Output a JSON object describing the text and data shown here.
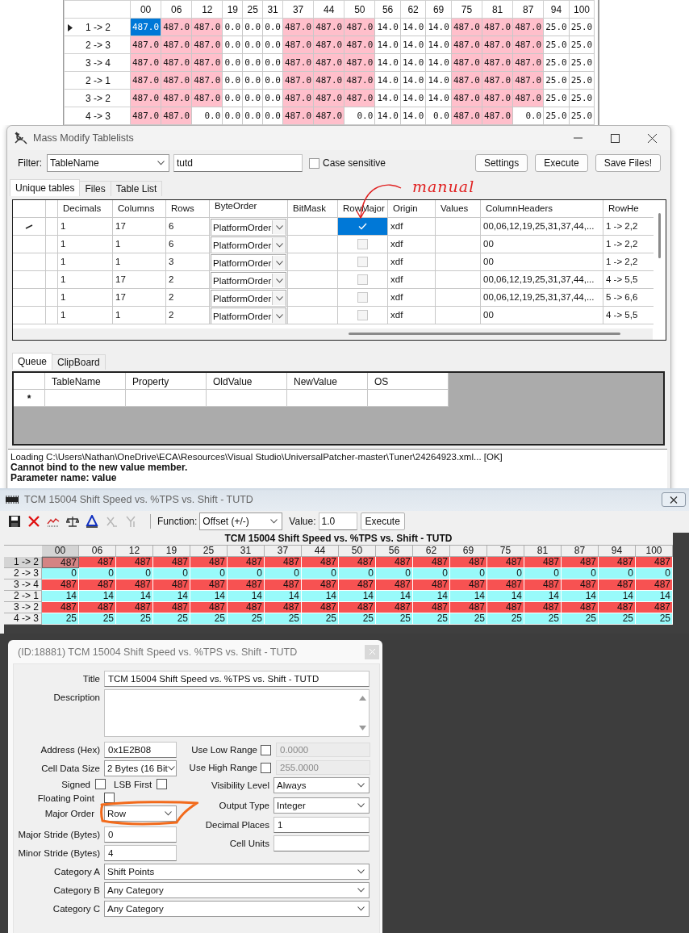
{
  "value_grid": {
    "columns": [
      "00",
      "06",
      "12",
      "19",
      "25",
      "31",
      "37",
      "44",
      "50",
      "56",
      "62",
      "69",
      "75",
      "81",
      "87",
      "94",
      "100"
    ],
    "rows": [
      {
        "label": "1 -> 2",
        "current": true,
        "cells": [
          {
            "value": "487.0",
            "highlighted": true,
            "selected": true
          },
          {
            "value": "487.0",
            "highlighted": true,
            "selected": false
          },
          {
            "value": "487.0",
            "highlighted": true,
            "selected": false
          },
          {
            "value": "0.0",
            "highlighted": false,
            "selected": false
          },
          {
            "value": "0.0",
            "highlighted": false,
            "selected": false
          },
          {
            "value": "0.0",
            "highlighted": false,
            "selected": false
          },
          {
            "value": "487.0",
            "highlighted": true,
            "selected": false
          },
          {
            "value": "487.0",
            "highlighted": true,
            "selected": false
          },
          {
            "value": "487.0",
            "highlighted": true,
            "selected": false
          },
          {
            "value": "14.0",
            "highlighted": false,
            "selected": false
          },
          {
            "value": "14.0",
            "highlighted": false,
            "selected": false
          },
          {
            "value": "14.0",
            "highlighted": false,
            "selected": false
          },
          {
            "value": "487.0",
            "highlighted": true,
            "selected": false
          },
          {
            "value": "487.0",
            "highlighted": true,
            "selected": false
          },
          {
            "value": "487.0",
            "highlighted": true,
            "selected": false
          },
          {
            "value": "25.0",
            "highlighted": false,
            "selected": false
          },
          {
            "value": "25.0",
            "highlighted": false,
            "selected": false
          }
        ]
      },
      {
        "label": "2 -> 3",
        "current": false,
        "cells": [
          {
            "value": "487.0",
            "highlighted": true,
            "selected": false
          },
          {
            "value": "487.0",
            "highlighted": true,
            "selected": false
          },
          {
            "value": "487.0",
            "highlighted": true,
            "selected": false
          },
          {
            "value": "0.0",
            "highlighted": false,
            "selected": false
          },
          {
            "value": "0.0",
            "highlighted": false,
            "selected": false
          },
          {
            "value": "0.0",
            "highlighted": false,
            "selected": false
          },
          {
            "value": "487.0",
            "highlighted": true,
            "selected": false
          },
          {
            "value": "487.0",
            "highlighted": true,
            "selected": false
          },
          {
            "value": "487.0",
            "highlighted": true,
            "selected": false
          },
          {
            "value": "14.0",
            "highlighted": false,
            "selected": false
          },
          {
            "value": "14.0",
            "highlighted": false,
            "selected": false
          },
          {
            "value": "14.0",
            "highlighted": false,
            "selected": false
          },
          {
            "value": "487.0",
            "highlighted": true,
            "selected": false
          },
          {
            "value": "487.0",
            "highlighted": true,
            "selected": false
          },
          {
            "value": "487.0",
            "highlighted": true,
            "selected": false
          },
          {
            "value": "25.0",
            "highlighted": false,
            "selected": false
          },
          {
            "value": "25.0",
            "highlighted": false,
            "selected": false
          }
        ]
      },
      {
        "label": "3 -> 4",
        "current": false,
        "cells": [
          {
            "value": "487.0",
            "highlighted": true,
            "selected": false
          },
          {
            "value": "487.0",
            "highlighted": true,
            "selected": false
          },
          {
            "value": "487.0",
            "highlighted": true,
            "selected": false
          },
          {
            "value": "0.0",
            "highlighted": false,
            "selected": false
          },
          {
            "value": "0.0",
            "highlighted": false,
            "selected": false
          },
          {
            "value": "0.0",
            "highlighted": false,
            "selected": false
          },
          {
            "value": "487.0",
            "highlighted": true,
            "selected": false
          },
          {
            "value": "487.0",
            "highlighted": true,
            "selected": false
          },
          {
            "value": "487.0",
            "highlighted": true,
            "selected": false
          },
          {
            "value": "14.0",
            "highlighted": false,
            "selected": false
          },
          {
            "value": "14.0",
            "highlighted": false,
            "selected": false
          },
          {
            "value": "14.0",
            "highlighted": false,
            "selected": false
          },
          {
            "value": "487.0",
            "highlighted": true,
            "selected": false
          },
          {
            "value": "487.0",
            "highlighted": true,
            "selected": false
          },
          {
            "value": "487.0",
            "highlighted": true,
            "selected": false
          },
          {
            "value": "25.0",
            "highlighted": false,
            "selected": false
          },
          {
            "value": "25.0",
            "highlighted": false,
            "selected": false
          }
        ]
      },
      {
        "label": "2 -> 1",
        "current": false,
        "cells": [
          {
            "value": "487.0",
            "highlighted": true,
            "selected": false
          },
          {
            "value": "487.0",
            "highlighted": true,
            "selected": false
          },
          {
            "value": "487.0",
            "highlighted": true,
            "selected": false
          },
          {
            "value": "0.0",
            "highlighted": false,
            "selected": false
          },
          {
            "value": "0.0",
            "highlighted": false,
            "selected": false
          },
          {
            "value": "0.0",
            "highlighted": false,
            "selected": false
          },
          {
            "value": "487.0",
            "highlighted": true,
            "selected": false
          },
          {
            "value": "487.0",
            "highlighted": true,
            "selected": false
          },
          {
            "value": "487.0",
            "highlighted": true,
            "selected": false
          },
          {
            "value": "14.0",
            "highlighted": false,
            "selected": false
          },
          {
            "value": "14.0",
            "highlighted": false,
            "selected": false
          },
          {
            "value": "14.0",
            "highlighted": false,
            "selected": false
          },
          {
            "value": "487.0",
            "highlighted": true,
            "selected": false
          },
          {
            "value": "487.0",
            "highlighted": true,
            "selected": false
          },
          {
            "value": "487.0",
            "highlighted": true,
            "selected": false
          },
          {
            "value": "25.0",
            "highlighted": false,
            "selected": false
          },
          {
            "value": "25.0",
            "highlighted": false,
            "selected": false
          }
        ]
      },
      {
        "label": "3 -> 2",
        "current": false,
        "cells": [
          {
            "value": "487.0",
            "highlighted": true,
            "selected": false
          },
          {
            "value": "487.0",
            "highlighted": true,
            "selected": false
          },
          {
            "value": "487.0",
            "highlighted": true,
            "selected": false
          },
          {
            "value": "0.0",
            "highlighted": false,
            "selected": false
          },
          {
            "value": "0.0",
            "highlighted": false,
            "selected": false
          },
          {
            "value": "0.0",
            "highlighted": false,
            "selected": false
          },
          {
            "value": "487.0",
            "highlighted": true,
            "selected": false
          },
          {
            "value": "487.0",
            "highlighted": true,
            "selected": false
          },
          {
            "value": "487.0",
            "highlighted": true,
            "selected": false
          },
          {
            "value": "14.0",
            "highlighted": false,
            "selected": false
          },
          {
            "value": "14.0",
            "highlighted": false,
            "selected": false
          },
          {
            "value": "14.0",
            "highlighted": false,
            "selected": false
          },
          {
            "value": "487.0",
            "highlighted": true,
            "selected": false
          },
          {
            "value": "487.0",
            "highlighted": true,
            "selected": false
          },
          {
            "value": "487.0",
            "highlighted": true,
            "selected": false
          },
          {
            "value": "25.0",
            "highlighted": false,
            "selected": false
          },
          {
            "value": "25.0",
            "highlighted": false,
            "selected": false
          }
        ]
      },
      {
        "label": "4 -> 3",
        "current": false,
        "cells": [
          {
            "value": "487.0",
            "highlighted": true,
            "selected": false
          },
          {
            "value": "487.0",
            "highlighted": true,
            "selected": false
          },
          {
            "value": "0.0",
            "highlighted": false,
            "selected": false
          },
          {
            "value": "0.0",
            "highlighted": false,
            "selected": false
          },
          {
            "value": "0.0",
            "highlighted": false,
            "selected": false
          },
          {
            "value": "0.0",
            "highlighted": false,
            "selected": false
          },
          {
            "value": "487.0",
            "highlighted": true,
            "selected": false
          },
          {
            "value": "487.0",
            "highlighted": true,
            "selected": false
          },
          {
            "value": "0.0",
            "highlighted": false,
            "selected": false
          },
          {
            "value": "14.0",
            "highlighted": false,
            "selected": false
          },
          {
            "value": "14.0",
            "highlighted": false,
            "selected": false
          },
          {
            "value": "0.0",
            "highlighted": false,
            "selected": false
          },
          {
            "value": "487.0",
            "highlighted": true,
            "selected": false
          },
          {
            "value": "487.0",
            "highlighted": true,
            "selected": false
          },
          {
            "value": "0.0",
            "highlighted": false,
            "selected": false
          },
          {
            "value": "25.0",
            "highlighted": false,
            "selected": false
          },
          {
            "value": "25.0",
            "highlighted": false,
            "selected": false
          }
        ]
      }
    ]
  },
  "mass_modify": {
    "title": "Mass Modify Tablelists",
    "filter_label": "Filter:",
    "filter_field": "TableName",
    "filter_text": "tutd",
    "case_sensitive": {
      "label": "Case sensitive",
      "checked": false
    },
    "buttons": [
      "Settings",
      "Execute",
      "Save Files!"
    ],
    "tabs": [
      {
        "label": "Unique tables",
        "selected": true
      },
      {
        "label": "Files",
        "selected": false
      },
      {
        "label": "Table List",
        "selected": false
      }
    ],
    "annotation": "manual",
    "columns": [
      "Decimals",
      "Columns",
      "Rows",
      "ByteOrder",
      "BitMask",
      "RowMajor",
      "Origin",
      "Values",
      "ColumnHeaders",
      "RowHe"
    ],
    "rows": [
      {
        "editing": true,
        "decimals": "1",
        "columns": "17",
        "rows": "6",
        "byte_order": "PlatformOrder",
        "row_major_checked": true,
        "row_major_selected": true,
        "origin": "xdf",
        "column_headers": "00,06,12,19,25,31,37,44,...",
        "row_headers": "1 -> 2,2"
      },
      {
        "editing": false,
        "decimals": "1",
        "columns": "1",
        "rows": "6",
        "byte_order": "PlatformOrder",
        "row_major_checked": false,
        "row_major_selected": false,
        "origin": "xdf",
        "column_headers": "00",
        "row_headers": "1 -> 2,2"
      },
      {
        "editing": false,
        "decimals": "1",
        "columns": "1",
        "rows": "3",
        "byte_order": "PlatformOrder",
        "row_major_checked": false,
        "row_major_selected": false,
        "origin": "xdf",
        "column_headers": "00",
        "row_headers": "1 -> 2,2"
      },
      {
        "editing": false,
        "decimals": "1",
        "columns": "17",
        "rows": "2",
        "byte_order": "PlatformOrder",
        "row_major_checked": false,
        "row_major_selected": false,
        "origin": "xdf",
        "column_headers": "00,06,12,19,25,31,37,44,...",
        "row_headers": "4 -> 5,5"
      },
      {
        "editing": false,
        "decimals": "1",
        "columns": "17",
        "rows": "2",
        "byte_order": "PlatformOrder",
        "row_major_checked": false,
        "row_major_selected": false,
        "origin": "xdf",
        "column_headers": "00,06,12,19,25,31,37,44,...",
        "row_headers": "5 -> 6,6"
      },
      {
        "editing": false,
        "decimals": "1",
        "columns": "1",
        "rows": "2",
        "byte_order": "PlatformOrder",
        "row_major_checked": false,
        "row_major_selected": false,
        "origin": "xdf",
        "column_headers": "00",
        "row_headers": "4 -> 5,5"
      }
    ],
    "queue_tabs": [
      {
        "label": "Queue",
        "selected": true
      },
      {
        "label": "ClipBoard",
        "selected": false
      }
    ],
    "queue_columns": [
      "TableName",
      "Property",
      "OldValue",
      "NewValue",
      "OS"
    ],
    "new_row_marker": "*",
    "log": [
      {
        "text": "Loading C:\\Users\\Nathan\\OneDrive\\ECA\\Resources\\Visual Studio\\UniversalPatcher-master\\Tuner\\24264923.xml... [OK]",
        "bold": false
      },
      {
        "text": "Cannot bind to the new value member.",
        "bold": true
      },
      {
        "text": "Parameter name: value",
        "bold": true
      }
    ]
  },
  "table_editor": {
    "title": "TCM 15004 Shift Speed vs. %TPS vs. Shift - TUTD",
    "toolbar": [
      {
        "kind": "save",
        "disabled": false
      },
      {
        "kind": "delete",
        "disabled": false
      },
      {
        "kind": "graph",
        "disabled": false
      },
      {
        "kind": "scale",
        "disabled": false
      },
      {
        "kind": "delta",
        "disabled": false
      },
      {
        "kind": "swap_x",
        "disabled": true
      },
      {
        "kind": "swap_y",
        "disabled": true
      }
    ],
    "function_label": "Function:",
    "function_value": "Offset (+/-)",
    "value_label": "Value:",
    "value": "1.0",
    "execute": "Execute",
    "table_title": "TCM 15004 Shift Speed vs. %TPS vs. Shift - TUTD",
    "columns": [
      {
        "label": "00",
        "selected": true
      },
      {
        "label": "06",
        "selected": false
      },
      {
        "label": "12",
        "selected": false
      },
      {
        "label": "19",
        "selected": false
      },
      {
        "label": "25",
        "selected": false
      },
      {
        "label": "31",
        "selected": false
      },
      {
        "label": "37",
        "selected": false
      },
      {
        "label": "44",
        "selected": false
      },
      {
        "label": "50",
        "selected": false
      },
      {
        "label": "56",
        "selected": false
      },
      {
        "label": "62",
        "selected": false
      },
      {
        "label": "69",
        "selected": false
      },
      {
        "label": "75",
        "selected": false
      },
      {
        "label": "81",
        "selected": false
      },
      {
        "label": "87",
        "selected": false
      },
      {
        "label": "94",
        "selected": false
      },
      {
        "label": "100",
        "selected": false
      }
    ],
    "rows": [
      {
        "label": "1 -> 2",
        "selected": true,
        "color": "#f75252",
        "cells": [
          {
            "value": "487",
            "selected": true
          },
          {
            "value": "487",
            "selected": false
          },
          {
            "value": "487",
            "selected": false
          },
          {
            "value": "487",
            "selected": false
          },
          {
            "value": "487",
            "selected": false
          },
          {
            "value": "487",
            "selected": false
          },
          {
            "value": "487",
            "selected": false
          },
          {
            "value": "487",
            "selected": false
          },
          {
            "value": "487",
            "selected": false
          },
          {
            "value": "487",
            "selected": false
          },
          {
            "value": "487",
            "selected": false
          },
          {
            "value": "487",
            "selected": false
          },
          {
            "value": "487",
            "selected": false
          },
          {
            "value": "487",
            "selected": false
          },
          {
            "value": "487",
            "selected": false
          },
          {
            "value": "487",
            "selected": false
          },
          {
            "value": "487",
            "selected": false
          }
        ]
      },
      {
        "label": "2 -> 3",
        "selected": false,
        "color": "#98fafa",
        "cells": [
          {
            "value": "0",
            "selected": false
          },
          {
            "value": "0",
            "selected": false
          },
          {
            "value": "0",
            "selected": false
          },
          {
            "value": "0",
            "selected": false
          },
          {
            "value": "0",
            "selected": false
          },
          {
            "value": "0",
            "selected": false
          },
          {
            "value": "0",
            "selected": false
          },
          {
            "value": "0",
            "selected": false
          },
          {
            "value": "0",
            "selected": false
          },
          {
            "value": "0",
            "selected": false
          },
          {
            "value": "0",
            "selected": false
          },
          {
            "value": "0",
            "selected": false
          },
          {
            "value": "0",
            "selected": false
          },
          {
            "value": "0",
            "selected": false
          },
          {
            "value": "0",
            "selected": false
          },
          {
            "value": "0",
            "selected": false
          },
          {
            "value": "0",
            "selected": false
          }
        ]
      },
      {
        "label": "3 -> 4",
        "selected": false,
        "color": "#f75252",
        "cells": [
          {
            "value": "487",
            "selected": false
          },
          {
            "value": "487",
            "selected": false
          },
          {
            "value": "487",
            "selected": false
          },
          {
            "value": "487",
            "selected": false
          },
          {
            "value": "487",
            "selected": false
          },
          {
            "value": "487",
            "selected": false
          },
          {
            "value": "487",
            "selected": false
          },
          {
            "value": "487",
            "selected": false
          },
          {
            "value": "487",
            "selected": false
          },
          {
            "value": "487",
            "selected": false
          },
          {
            "value": "487",
            "selected": false
          },
          {
            "value": "487",
            "selected": false
          },
          {
            "value": "487",
            "selected": false
          },
          {
            "value": "487",
            "selected": false
          },
          {
            "value": "487",
            "selected": false
          },
          {
            "value": "487",
            "selected": false
          },
          {
            "value": "487",
            "selected": false
          }
        ]
      },
      {
        "label": "2 -> 1",
        "selected": false,
        "color": "#98fafa",
        "cells": [
          {
            "value": "14",
            "selected": false
          },
          {
            "value": "14",
            "selected": false
          },
          {
            "value": "14",
            "selected": false
          },
          {
            "value": "14",
            "selected": false
          },
          {
            "value": "14",
            "selected": false
          },
          {
            "value": "14",
            "selected": false
          },
          {
            "value": "14",
            "selected": false
          },
          {
            "value": "14",
            "selected": false
          },
          {
            "value": "14",
            "selected": false
          },
          {
            "value": "14",
            "selected": false
          },
          {
            "value": "14",
            "selected": false
          },
          {
            "value": "14",
            "selected": false
          },
          {
            "value": "14",
            "selected": false
          },
          {
            "value": "14",
            "selected": false
          },
          {
            "value": "14",
            "selected": false
          },
          {
            "value": "14",
            "selected": false
          },
          {
            "value": "14",
            "selected": false
          }
        ]
      },
      {
        "label": "3 -> 2",
        "selected": false,
        "color": "#f75252",
        "cells": [
          {
            "value": "487",
            "selected": false
          },
          {
            "value": "487",
            "selected": false
          },
          {
            "value": "487",
            "selected": false
          },
          {
            "value": "487",
            "selected": false
          },
          {
            "value": "487",
            "selected": false
          },
          {
            "value": "487",
            "selected": false
          },
          {
            "value": "487",
            "selected": false
          },
          {
            "value": "487",
            "selected": false
          },
          {
            "value": "487",
            "selected": false
          },
          {
            "value": "487",
            "selected": false
          },
          {
            "value": "487",
            "selected": false
          },
          {
            "value": "487",
            "selected": false
          },
          {
            "value": "487",
            "selected": false
          },
          {
            "value": "487",
            "selected": false
          },
          {
            "value": "487",
            "selected": false
          },
          {
            "value": "487",
            "selected": false
          },
          {
            "value": "487",
            "selected": false
          }
        ]
      },
      {
        "label": "4 -> 3",
        "selected": false,
        "color": "#98fafa",
        "cells": [
          {
            "value": "25",
            "selected": false
          },
          {
            "value": "25",
            "selected": false
          },
          {
            "value": "25",
            "selected": false
          },
          {
            "value": "25",
            "selected": false
          },
          {
            "value": "25",
            "selected": false
          },
          {
            "value": "25",
            "selected": false
          },
          {
            "value": "25",
            "selected": false
          },
          {
            "value": "25",
            "selected": false
          },
          {
            "value": "25",
            "selected": false
          },
          {
            "value": "25",
            "selected": false
          },
          {
            "value": "25",
            "selected": false
          },
          {
            "value": "25",
            "selected": false
          },
          {
            "value": "25",
            "selected": false
          },
          {
            "value": "25",
            "selected": false
          },
          {
            "value": "25",
            "selected": false
          },
          {
            "value": "25",
            "selected": false
          },
          {
            "value": "25",
            "selected": false
          }
        ]
      }
    ]
  },
  "properties_dialog": {
    "title": "(ID:18881) TCM 15004 Shift Speed vs. %TPS vs. Shift - TUTD",
    "name_field": {
      "label": "Title",
      "value": "TCM 15004 Shift Speed vs. %TPS vs. Shift - TUTD"
    },
    "description": {
      "label": "Description"
    },
    "address": {
      "label": "Address (Hex)",
      "value": "0x1E2B08"
    },
    "cell_data_size": {
      "label": "Cell Data Size",
      "value": "2 Bytes (16 Bit"
    },
    "signed": {
      "label": "Signed",
      "checked": false
    },
    "lsb_first": {
      "label": "LSB First",
      "checked": false
    },
    "floating_point": {
      "label": "Floating Point",
      "checked": false
    },
    "major_order": {
      "label": "Major Order",
      "value": "Row"
    },
    "major_stride": {
      "label": "Major Stride (Bytes)",
      "value": "0"
    },
    "minor_stride": {
      "label": "Minor Stride (Bytes)",
      "value": "4"
    },
    "low_range": {
      "label": "Use Low Range",
      "checked": false,
      "value": "0.0000"
    },
    "high_range": {
      "label": "Use High Range",
      "checked": false,
      "value": "255.0000"
    },
    "visibility_level": {
      "label": "Visibility Level",
      "value": "Always"
    },
    "output_type": {
      "label": "Output Type",
      "value": "Integer"
    },
    "decimal_places": {
      "label": "Decimal Places",
      "value": "1"
    },
    "cell_units": {
      "label": "Cell Units"
    },
    "categories": [
      {
        "label": "Category A",
        "value": "Shift Points"
      },
      {
        "label": "Category B",
        "value": "Any Category"
      },
      {
        "label": "Category C",
        "value": "Any Category"
      }
    ]
  }
}
